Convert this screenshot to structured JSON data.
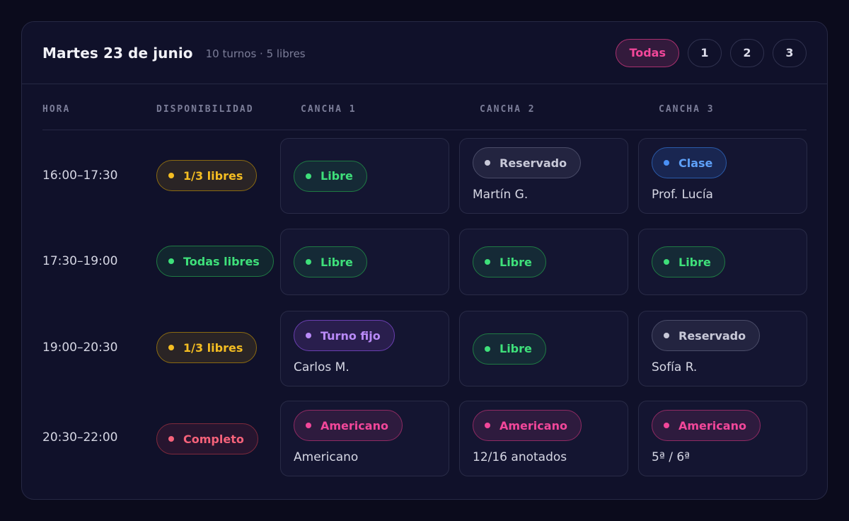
{
  "header": {
    "title": "Martes 23 de junio",
    "subtitle": "10 turnos · 5 libres",
    "filters": [
      "Todas",
      "1",
      "2",
      "3"
    ],
    "active_filter": "Todas"
  },
  "columns": [
    "HORA",
    "DISPONIBILIDAD",
    "CANCHA 1",
    "CANCHA 2",
    "CANCHA 3"
  ],
  "colors": {
    "libre": "#3ee07a",
    "parcial": "#f4bd22",
    "completo": "#f5627a",
    "americano": "#f2479a",
    "clase": "#5ea0f8",
    "turno_fijo": "#b98af8",
    "reservado": "#c8c9d8"
  },
  "rows": [
    {
      "time": "16:00–17:30",
      "availability": "1/3 libres",
      "courts": [
        {
          "status": "Libre",
          "detail": ""
        },
        {
          "status": "Reservado",
          "detail": "Martín G."
        },
        {
          "status": "Clase",
          "detail": "Prof. Lucía"
        }
      ]
    },
    {
      "time": "17:30–19:00",
      "availability": "Todas libres",
      "courts": [
        {
          "status": "Libre",
          "detail": ""
        },
        {
          "status": "Libre",
          "detail": ""
        },
        {
          "status": "Libre",
          "detail": ""
        }
      ]
    },
    {
      "time": "19:00–20:30",
      "availability": "1/3 libres",
      "courts": [
        {
          "status": "Turno fijo",
          "detail": "Carlos M."
        },
        {
          "status": "Libre",
          "detail": ""
        },
        {
          "status": "Reservado",
          "detail": "Sofía R."
        }
      ]
    },
    {
      "time": "20:30–22:00",
      "availability": "Completo",
      "courts": [
        {
          "status": "Americano",
          "detail": "Americano"
        },
        {
          "status": "Americano",
          "detail": "12/16 anotados"
        },
        {
          "status": "Americano",
          "detail": "5ª / 6ª"
        }
      ]
    }
  ]
}
